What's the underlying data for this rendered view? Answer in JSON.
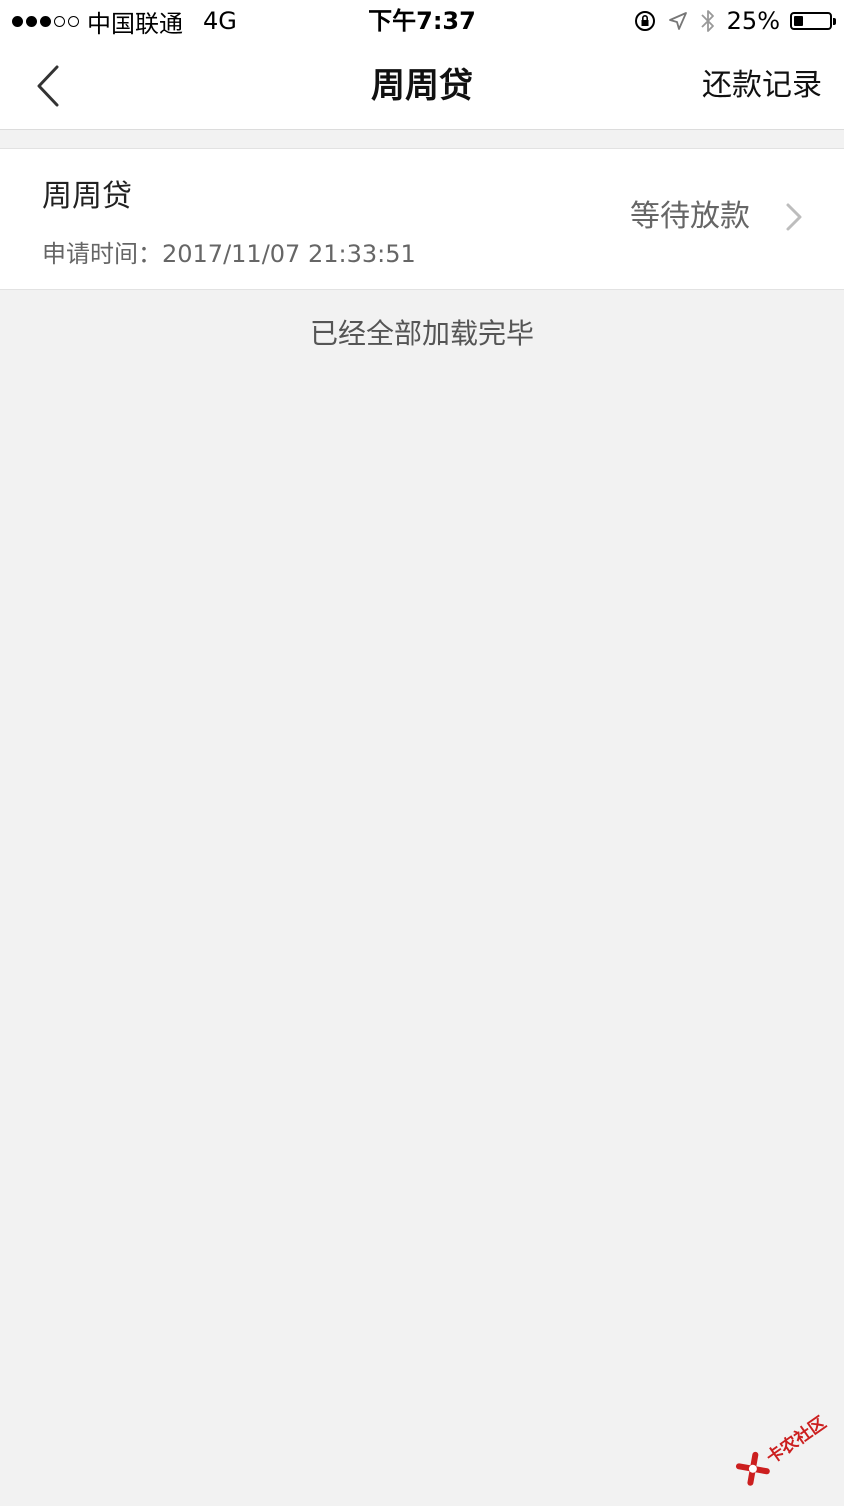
{
  "status_bar": {
    "carrier": "中国联通",
    "network": "4G",
    "time": "下午7:37",
    "battery_percent": "25%",
    "battery_level": 0.25,
    "signal_bars_filled": 3,
    "signal_bars_total": 5
  },
  "nav": {
    "title": "周周贷",
    "right_action": "还款记录"
  },
  "loan_list": {
    "items": [
      {
        "name": "周周贷",
        "apply_time_label": "申请时间：2017/11/07 21:33:51",
        "status": "等待放款"
      }
    ],
    "footer": "已经全部加载完毕"
  },
  "watermark": {
    "text": "卡农社区",
    "color": "#cc1f1f"
  },
  "colors": {
    "background": "#f2f2f2",
    "card": "#ffffff",
    "secondary_text": "#666666"
  }
}
